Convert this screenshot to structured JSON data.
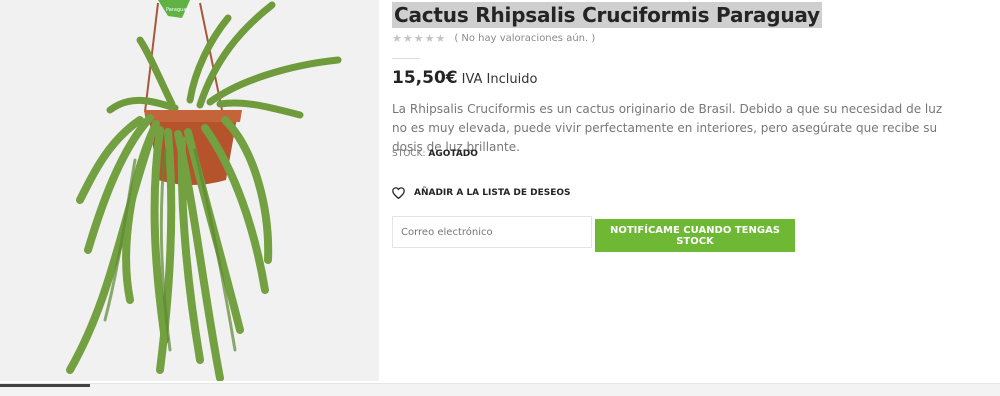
{
  "product": {
    "title": "Cactus Rhipsalis Cruciformis Paraguay",
    "image_alt": "Cactus Rhipsalis Cruciformis Paraguay en maceta colgante",
    "image_tag": "Paraguay",
    "rating": {
      "stars": "★★★★★",
      "text": "( No hay valoraciones aún. )"
    },
    "price": {
      "amount": "15,50€",
      "suffix": "IVA Incluido"
    },
    "description": "La Rhipsalis Cruciformis es un cactus originario de Brasil. Debido a que su necesidad de luz no es muy elevada, puede vivir perfectamente en interiores, pero asegúrate que recibe su dosis de luz brillante.",
    "stock": {
      "label": "STOCK:",
      "value": "AGOTADO"
    },
    "wishlist": {
      "label": "AÑADIR A LA LISTA DE DESEOS",
      "icon": "heart-icon"
    },
    "notify": {
      "placeholder": "Correo electrónico",
      "button_label": "NOTIFÍCAME CUANDO TENGAS STOCK"
    }
  },
  "colors": {
    "accent_green": "#6fb835",
    "title_highlight": "#cfcfcf",
    "text_dark": "#242424",
    "text_muted": "#777777",
    "pot": "#b5542c",
    "plant": "#6f9b3c"
  }
}
